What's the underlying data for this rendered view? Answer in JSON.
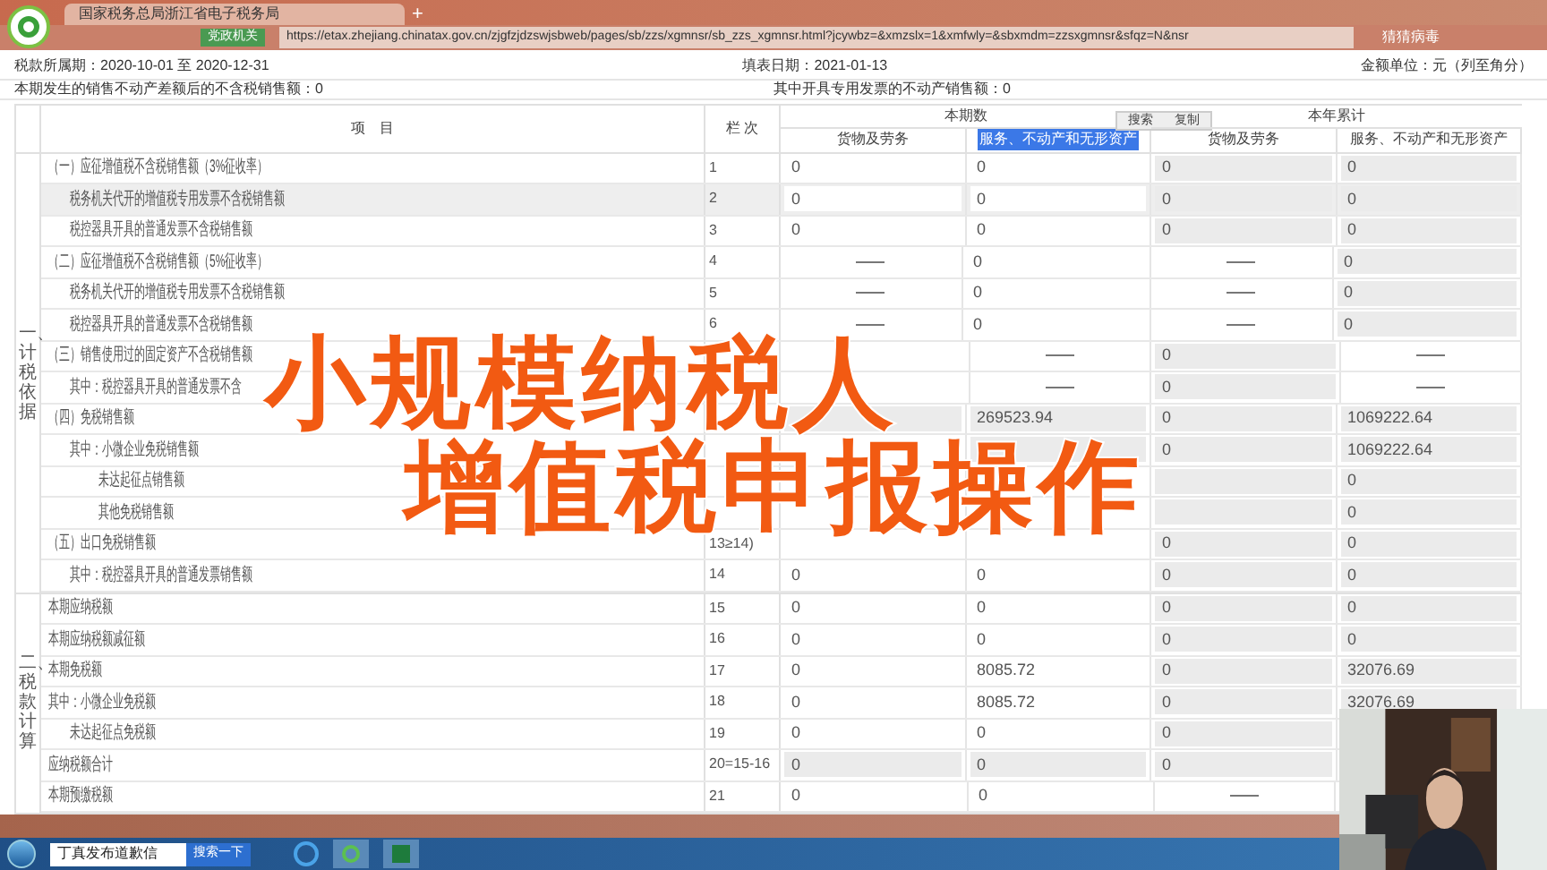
{
  "browser": {
    "tab_title": "国家税务总局浙江省电子税务局",
    "new_tab": "+",
    "badge": "党政机关",
    "url": "https://etax.zhejiang.chinatax.gov.cn/zjgfzjdzswjsbweb/pages/sb/zzs/xgmnsr/sb_zzs_xgmnsr.html?jcywbz=&xmzslx=1&xmfwly=&sbxmdm=zzsxgmnsr&sfqz=N&nsr",
    "extension": "猜猜病毒"
  },
  "form": {
    "period": "税款所属期：2020-10-01 至 2020-12-31",
    "fill_date": "填表日期：2021-01-13",
    "unit": "金额单位：元（列至角分）",
    "summary": [
      {
        "label": "本期发生的销售不动产差额后的不含税销售额：",
        "value": "0"
      },
      {
        "label": "其中开具专用发票的不动产销售额：",
        "value": "0"
      }
    ]
  },
  "table": {
    "item_header": "项　目",
    "line_header": "栏 次",
    "groups": [
      {
        "label": "本期数",
        "subcolumns": [
          {
            "label": "货物及劳务",
            "highlighted": false
          },
          {
            "label": "服务、不动产和无形资产",
            "highlighted": true
          }
        ]
      },
      {
        "label": "本年累计",
        "subcolumns": [
          {
            "label": "货物及劳务",
            "highlighted": false
          },
          {
            "label": "服务、不动产和无形资产",
            "highlighted": false
          }
        ]
      }
    ],
    "context_menu": [
      "搜索",
      "复制"
    ],
    "sections": [
      {
        "label": "一、计税依据",
        "rows": [
          {
            "kind": "heading",
            "label": "（一）应征增值税不含税销售额（3%征收率）",
            "line": "1",
            "highlighted": false,
            "cells": [
              {
                "kind": "input",
                "value": "0"
              },
              {
                "kind": "input",
                "value": "0"
              },
              {
                "kind": "readonly",
                "value": "0"
              },
              {
                "kind": "readonly",
                "value": "0"
              }
            ]
          },
          {
            "kind": "sub",
            "label": "税务机关代开的增值税专用发票不含税销售额",
            "line": "2",
            "highlighted": true,
            "cells": [
              {
                "kind": "input",
                "value": "0"
              },
              {
                "kind": "input",
                "value": "0"
              },
              {
                "kind": "readonly",
                "value": "0"
              },
              {
                "kind": "readonly",
                "value": "0"
              }
            ]
          },
          {
            "kind": "sub",
            "label": "税控器具开具的普通发票不含税销售额",
            "line": "3",
            "highlighted": false,
            "cells": [
              {
                "kind": "input",
                "value": "0"
              },
              {
                "kind": "input",
                "value": "0"
              },
              {
                "kind": "readonly",
                "value": "0"
              },
              {
                "kind": "readonly",
                "value": "0"
              }
            ]
          },
          {
            "kind": "heading",
            "label": "（二）应征增值税不含税销售额（5%征收率）",
            "line": "4",
            "highlighted": false,
            "cells": [
              {
                "kind": "dash"
              },
              {
                "kind": "input",
                "value": "0"
              },
              {
                "kind": "dash"
              },
              {
                "kind": "readonly",
                "value": "0"
              }
            ]
          },
          {
            "kind": "sub",
            "label": "税务机关代开的增值税专用发票不含税销售额",
            "line": "5",
            "highlighted": false,
            "cells": [
              {
                "kind": "dash"
              },
              {
                "kind": "input",
                "value": "0"
              },
              {
                "kind": "dash"
              },
              {
                "kind": "readonly",
                "value": "0"
              }
            ]
          },
          {
            "kind": "sub",
            "label": "税控器具开具的普通发票不含税销售额",
            "line": "6",
            "highlighted": false,
            "cells": [
              {
                "kind": "dash"
              },
              {
                "kind": "input",
                "value": "0"
              },
              {
                "kind": "dash"
              },
              {
                "kind": "readonly",
                "value": "0"
              }
            ]
          },
          {
            "kind": "heading",
            "label": "（三）销售使用过的固定资产不含税销售额",
            "highlighted": false,
            "cells": [
              {
                "kind": "input"
              },
              {
                "kind": "dash"
              },
              {
                "kind": "readonly",
                "value": "0"
              },
              {
                "kind": "dash"
              }
            ]
          },
          {
            "kind": "sub",
            "label": "其中：税控器具开具的普通发票不含",
            "highlighted": false,
            "cells": [
              {
                "kind": "input"
              },
              {
                "kind": "dash"
              },
              {
                "kind": "readonly",
                "value": "0"
              },
              {
                "kind": "dash"
              }
            ]
          },
          {
            "kind": "heading",
            "label": "（四）免税销售额",
            "highlighted": false,
            "cells": [
              {
                "kind": "readonly"
              },
              {
                "kind": "readonly",
                "value": "269523.94"
              },
              {
                "kind": "readonly",
                "value": "0"
              },
              {
                "kind": "readonly",
                "value": "1069222.64"
              }
            ]
          },
          {
            "kind": "sub",
            "label": "其中：小微企业免税销售额",
            "highlighted": false,
            "cells": [
              {
                "kind": "input"
              },
              {
                "kind": "readonly"
              },
              {
                "kind": "readonly",
                "value": "0"
              },
              {
                "kind": "readonly",
                "value": "1069222.64"
              }
            ]
          },
          {
            "kind": "subsub",
            "label": "未达起征点销售额",
            "highlighted": false,
            "cells": [
              {
                "kind": "input"
              },
              {
                "kind": "input"
              },
              {
                "kind": "readonly"
              },
              {
                "kind": "readonly",
                "value": "0"
              }
            ]
          },
          {
            "kind": "subsub",
            "label": "其他免税销售额",
            "highlighted": false,
            "cells": [
              {
                "kind": "input"
              },
              {
                "kind": "input"
              },
              {
                "kind": "readonly"
              },
              {
                "kind": "readonly",
                "value": "0"
              }
            ]
          },
          {
            "kind": "heading",
            "label": "（五）出口免税销售额",
            "line": "13≥14)",
            "highlighted": false,
            "cells": [
              {
                "kind": "input"
              },
              {
                "kind": "input"
              },
              {
                "kind": "readonly",
                "value": "0"
              },
              {
                "kind": "readonly",
                "value": "0"
              }
            ]
          },
          {
            "kind": "sub",
            "label": "其中：税控器具开具的普通发票销售额",
            "line": "14",
            "highlighted": false,
            "cells": [
              {
                "kind": "input",
                "value": "0"
              },
              {
                "kind": "input",
                "value": "0"
              },
              {
                "kind": "readonly",
                "value": "0"
              },
              {
                "kind": "readonly",
                "value": "0"
              }
            ]
          }
        ]
      },
      {
        "label": "二、税款计算",
        "rows": [
          {
            "kind": "plain",
            "label": "本期应纳税额",
            "line": "15",
            "highlighted": false,
            "cells": [
              {
                "kind": "input",
                "value": "0"
              },
              {
                "kind": "input",
                "value": "0"
              },
              {
                "kind": "readonly",
                "value": "0"
              },
              {
                "kind": "readonly",
                "value": "0"
              }
            ]
          },
          {
            "kind": "plain",
            "label": "本期应纳税额减征额",
            "line": "16",
            "highlighted": false,
            "cells": [
              {
                "kind": "input",
                "value": "0"
              },
              {
                "kind": "input",
                "value": "0"
              },
              {
                "kind": "readonly",
                "value": "0"
              },
              {
                "kind": "readonly",
                "value": "0"
              }
            ]
          },
          {
            "kind": "plain",
            "label": "本期免税额",
            "line": "17",
            "highlighted": false,
            "cells": [
              {
                "kind": "input",
                "value": "0"
              },
              {
                "kind": "input",
                "value": "8085.72"
              },
              {
                "kind": "readonly",
                "value": "0"
              },
              {
                "kind": "readonly",
                "value": "32076.69"
              }
            ]
          },
          {
            "kind": "plain",
            "label": "其中：小微企业免税额",
            "line": "18",
            "highlighted": false,
            "cells": [
              {
                "kind": "input",
                "value": "0"
              },
              {
                "kind": "input",
                "value": "8085.72"
              },
              {
                "kind": "readonly",
                "value": "0"
              },
              {
                "kind": "readonly",
                "value": "32076.69"
              }
            ]
          },
          {
            "kind": "sub",
            "label": "未达起征点免税额",
            "line": "19",
            "highlighted": false,
            "cells": [
              {
                "kind": "input",
                "value": "0"
              },
              {
                "kind": "input",
                "value": "0"
              },
              {
                "kind": "readonly",
                "value": "0"
              },
              {
                "kind": "readonly"
              }
            ]
          },
          {
            "kind": "plain",
            "label": "应纳税额合计",
            "line": "20=15-16",
            "highlighted": false,
            "cells": [
              {
                "kind": "readonly",
                "value": "0"
              },
              {
                "kind": "readonly",
                "value": "0"
              },
              {
                "kind": "readonly",
                "value": "0"
              },
              {
                "kind": "readonly"
              }
            ]
          },
          {
            "kind": "plain",
            "label": "本期预缴税额",
            "line": "21",
            "highlighted": false,
            "cells": [
              {
                "kind": "input",
                "value": "0"
              },
              {
                "kind": "input",
                "value": "0"
              },
              {
                "kind": "dash"
              },
              {
                "kind": "readonly"
              }
            ]
          }
        ]
      }
    ]
  },
  "caption": [
    "小规模纳税人",
    "增值税申报操作"
  ],
  "taskbar": {
    "search_value": "丁真发布道歉信",
    "search_button": "搜索一下"
  }
}
